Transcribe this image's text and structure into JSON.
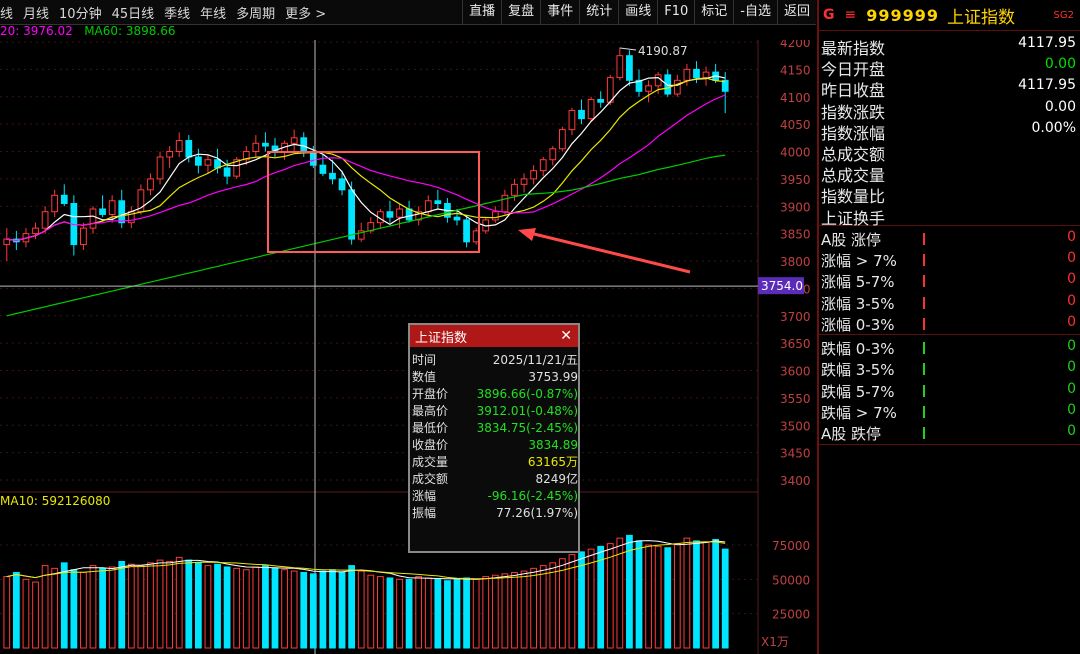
{
  "toolbar": {
    "left_items": [
      "线",
      "月线",
      "10分钟",
      "45日线",
      "季线",
      "年线",
      "多周期",
      "更多 >"
    ],
    "right_items": [
      "直播",
      "复盘",
      "事件",
      "统计",
      "画线",
      "F10",
      "标记",
      "-自选",
      "返回"
    ]
  },
  "ma_legend": {
    "ma20": "20: 3976.02",
    "ma60": "MA60: 3898.66"
  },
  "price_axis": [
    "4200",
    "4150",
    "4100",
    "4050",
    "4000",
    "3950",
    "3900",
    "3850",
    "3800",
    "3750",
    "3700",
    "3650",
    "3600",
    "3550",
    "3500",
    "3450",
    "3400"
  ],
  "crosshair_price": "3754.0",
  "high_annotation": "4190.87",
  "volume": {
    "legend": "MA10: 592126080",
    "axis": [
      "75000",
      "50000",
      "25000"
    ],
    "unit": "X1万"
  },
  "colors": {
    "up": "#ff3a3a",
    "down": "#00e5ff",
    "ma5": "#ffffff",
    "ma10": "#e8e800",
    "ma20": "#ff00ff",
    "ma60": "#00cc00",
    "box": "#ff5b5b",
    "arrow": "#ff4a4a"
  },
  "panel": {
    "header": {
      "g": "G",
      "eq": "≡",
      "code": "999999",
      "name": "上证指数",
      "tag": "SG2"
    },
    "quotes": [
      {
        "label": "最新指数",
        "value": "4117.95",
        "color": "#ffffff"
      },
      {
        "label": "今日开盘",
        "value": "0.00",
        "color": "#00e000"
      },
      {
        "label": "昨日收盘",
        "value": "4117.95",
        "color": "#ffffff"
      },
      {
        "label": "指数涨跌",
        "value": "0.00",
        "color": "#ffffff"
      },
      {
        "label": "指数涨幅",
        "value": "0.00%",
        "color": "#ffffff"
      },
      {
        "label": "总成交额",
        "value": "",
        "color": "#ffffff"
      },
      {
        "label": "总成交量",
        "value": "",
        "color": "#ffffff"
      },
      {
        "label": "指数量比",
        "value": "",
        "color": "#ffffff"
      },
      {
        "label": "上证换手",
        "value": "",
        "color": "#ffffff"
      }
    ],
    "rise_rows": [
      {
        "label": "A股 涨停",
        "value": "0"
      },
      {
        "label": "涨幅 > 7%",
        "value": "0"
      },
      {
        "label": "涨幅 5-7%",
        "value": "0"
      },
      {
        "label": "涨幅 3-5%",
        "value": "0"
      },
      {
        "label": "涨幅 0-3%",
        "value": "0"
      }
    ],
    "fall_rows": [
      {
        "label": "跌幅 0-3%",
        "value": "0"
      },
      {
        "label": "跌幅 3-5%",
        "value": "0"
      },
      {
        "label": "跌幅 5-7%",
        "value": "0"
      },
      {
        "label": "跌幅 > 7%",
        "value": "0"
      },
      {
        "label": "A股 跌停",
        "value": "0"
      }
    ]
  },
  "popup": {
    "title": "上证指数",
    "rows": [
      {
        "k": "时间",
        "v": "2025/11/21/五",
        "c": "#e0e0e0"
      },
      {
        "k": "数值",
        "v": "3753.99",
        "c": "#e0e0e0"
      },
      {
        "k": "开盘价",
        "v": "3896.66(-0.87%)",
        "c": "#20e020"
      },
      {
        "k": "最高价",
        "v": "3912.01(-0.48%)",
        "c": "#20e020"
      },
      {
        "k": "最低价",
        "v": "3834.75(-2.45%)",
        "c": "#20e020"
      },
      {
        "k": "收盘价",
        "v": "3834.89",
        "c": "#20e020"
      },
      {
        "k": "成交量",
        "v": "63165万",
        "c": "#e8e800"
      },
      {
        "k": "成交额",
        "v": "8249亿",
        "c": "#e0e0e0"
      },
      {
        "k": "涨幅",
        "v": "-96.16(-2.45%)",
        "c": "#20e020"
      },
      {
        "k": "振幅",
        "v": "77.26(1.97%)",
        "c": "#e0e0e0"
      }
    ]
  },
  "chart_data": {
    "type": "candlestick",
    "ylim": [
      3380,
      4220
    ],
    "ohlc": [
      [
        3830,
        3860,
        3800,
        3840
      ],
      [
        3840,
        3855,
        3820,
        3835
      ],
      [
        3835,
        3860,
        3825,
        3850
      ],
      [
        3850,
        3870,
        3840,
        3860
      ],
      [
        3860,
        3900,
        3850,
        3890
      ],
      [
        3890,
        3930,
        3880,
        3920
      ],
      [
        3920,
        3940,
        3900,
        3905
      ],
      [
        3905,
        3920,
        3810,
        3830
      ],
      [
        3830,
        3870,
        3820,
        3860
      ],
      [
        3860,
        3900,
        3850,
        3895
      ],
      [
        3895,
        3920,
        3880,
        3885
      ],
      [
        3885,
        3920,
        3870,
        3910
      ],
      [
        3910,
        3930,
        3860,
        3870
      ],
      [
        3870,
        3900,
        3860,
        3890
      ],
      [
        3890,
        3940,
        3885,
        3930
      ],
      [
        3930,
        3960,
        3920,
        3950
      ],
      [
        3950,
        4000,
        3940,
        3990
      ],
      [
        3990,
        4010,
        3970,
        4000
      ],
      [
        4000,
        4035,
        3990,
        4020
      ],
      [
        4020,
        4030,
        3980,
        3990
      ],
      [
        3990,
        4005,
        3960,
        3975
      ],
      [
        3975,
        3995,
        3960,
        3985
      ],
      [
        3985,
        4005,
        3960,
        3970
      ],
      [
        3970,
        3985,
        3940,
        3955
      ],
      [
        3955,
        3990,
        3950,
        3985
      ],
      [
        3985,
        4010,
        3975,
        4000
      ],
      [
        4000,
        4030,
        3990,
        4015
      ],
      [
        4015,
        4035,
        4000,
        4010
      ],
      [
        4010,
        4025,
        3990,
        4000
      ],
      [
        4000,
        4020,
        3985,
        4015
      ],
      [
        4015,
        4040,
        4000,
        4025
      ],
      [
        4025,
        4035,
        3990,
        4000
      ],
      [
        4000,
        4010,
        3970,
        3975
      ],
      [
        3975,
        3995,
        3955,
        3960
      ],
      [
        3960,
        3985,
        3940,
        3950
      ],
      [
        3950,
        3965,
        3920,
        3930
      ],
      [
        3930,
        3945,
        3830,
        3840
      ],
      [
        3840,
        3870,
        3835,
        3855
      ],
      [
        3855,
        3880,
        3850,
        3870
      ],
      [
        3870,
        3895,
        3860,
        3890
      ],
      [
        3890,
        3910,
        3870,
        3880
      ],
      [
        3880,
        3905,
        3860,
        3895
      ],
      [
        3895,
        3910,
        3870,
        3875
      ],
      [
        3875,
        3900,
        3865,
        3890
      ],
      [
        3890,
        3920,
        3880,
        3910
      ],
      [
        3910,
        3930,
        3895,
        3905
      ],
      [
        3905,
        3915,
        3870,
        3880
      ],
      [
        3880,
        3895,
        3865,
        3875
      ],
      [
        3875,
        3880,
        3825,
        3835
      ],
      [
        3835,
        3860,
        3830,
        3855
      ],
      [
        3855,
        3880,
        3850,
        3875
      ],
      [
        3875,
        3900,
        3870,
        3890
      ],
      [
        3890,
        3930,
        3885,
        3920
      ],
      [
        3920,
        3950,
        3910,
        3940
      ],
      [
        3940,
        3960,
        3925,
        3950
      ],
      [
        3950,
        3975,
        3940,
        3965
      ],
      [
        3965,
        3990,
        3955,
        3985
      ],
      [
        3985,
        4010,
        3975,
        4005
      ],
      [
        4005,
        4045,
        4000,
        4040
      ],
      [
        4040,
        4080,
        4030,
        4075
      ],
      [
        4075,
        4095,
        4050,
        4060
      ],
      [
        4060,
        4100,
        4055,
        4095
      ],
      [
        4095,
        4110,
        4080,
        4090
      ],
      [
        4090,
        4140,
        4085,
        4135
      ],
      [
        4135,
        4190,
        4130,
        4175
      ],
      [
        4175,
        4185,
        4120,
        4130
      ],
      [
        4130,
        4150,
        4100,
        4110
      ],
      [
        4110,
        4130,
        4090,
        4120
      ],
      [
        4120,
        4145,
        4105,
        4140
      ],
      [
        4140,
        4150,
        4100,
        4105
      ],
      [
        4105,
        4140,
        4100,
        4130
      ],
      [
        4130,
        4160,
        4120,
        4150
      ],
      [
        4150,
        4165,
        4125,
        4135
      ],
      [
        4135,
        4155,
        4120,
        4145
      ],
      [
        4145,
        4160,
        4125,
        4130
      ],
      [
        4130,
        4145,
        4070,
        4110
      ]
    ],
    "volume": [
      52,
      55,
      50,
      48,
      60,
      58,
      62,
      57,
      55,
      60,
      58,
      59,
      63,
      61,
      60,
      62,
      64,
      63,
      66,
      64,
      62,
      60,
      61,
      59,
      58,
      57,
      59,
      60,
      58,
      57,
      56,
      55,
      54,
      56,
      57,
      55,
      60,
      56,
      53,
      52,
      51,
      50,
      50,
      52,
      51,
      50,
      49,
      50,
      51,
      50,
      52,
      53,
      54,
      55,
      56,
      58,
      60,
      62,
      65,
      68,
      70,
      72,
      74,
      76,
      80,
      82,
      78,
      75,
      74,
      73,
      76,
      80,
      78,
      77,
      79,
      72
    ]
  }
}
